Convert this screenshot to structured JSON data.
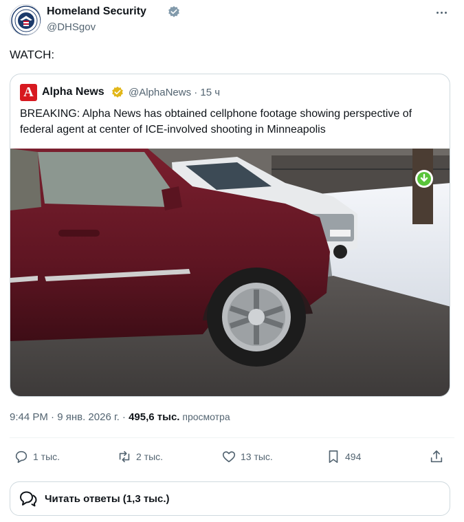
{
  "author": {
    "name": "Homeland Security",
    "handle": "@DHSgov"
  },
  "post": {
    "text": "WATCH:"
  },
  "quoted": {
    "logo_letter": "A",
    "name": "Alpha News",
    "handle_time": "@AlphaNews · 15 ч",
    "text": "BREAKING: Alpha News has obtained cellphone footage showing perspective of federal agent at center of ICE-involved shooting in Minneapolis"
  },
  "meta": {
    "time_date": "9:44 PM · 9 янв. 2026 г. · ",
    "views_count": "495,6 тыс.",
    "views_label": " просмотра"
  },
  "actions": {
    "replies": "1 тыс.",
    "reposts": "2 тыс.",
    "likes": "13 тыс.",
    "bookmarks": "494"
  },
  "reply_prompt": "Читать ответы (1,3 тыс.)",
  "colors": {
    "verified_blue": "#1d9bf0",
    "verified_gold": "#e2b719",
    "alpha_red": "#d71920",
    "muted_text": "#536471"
  }
}
